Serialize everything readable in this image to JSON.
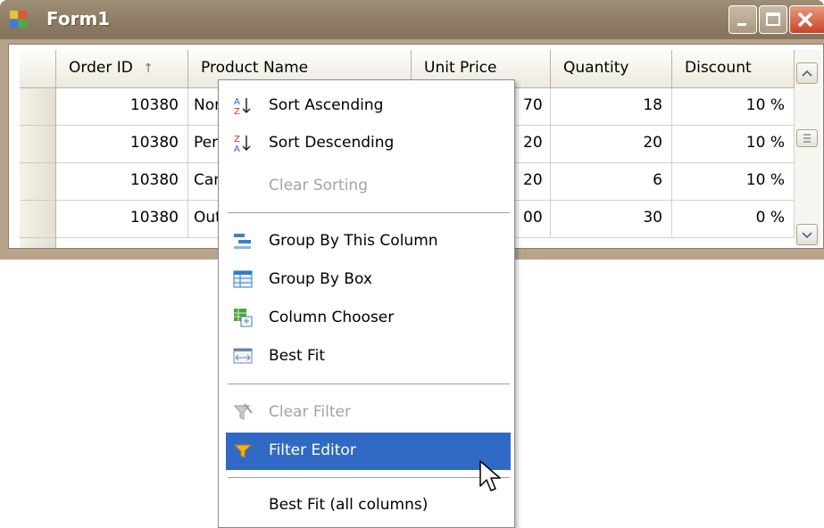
{
  "window": {
    "title": "Form1"
  },
  "grid": {
    "columns": [
      {
        "label": "Order ID",
        "sort_icon": "↑"
      },
      {
        "label": "Product Name"
      },
      {
        "label": "Unit Price"
      },
      {
        "label": "Quantity"
      },
      {
        "label": "Discount"
      }
    ],
    "rows": [
      {
        "order_id": "10380",
        "product": "Nord",
        "price": "70",
        "quantity": "18",
        "discount": "10 %"
      },
      {
        "order_id": "10380",
        "product": "Pert",
        "price": "20",
        "quantity": "20",
        "discount": "10 %"
      },
      {
        "order_id": "10380",
        "product": "Cam",
        "price": "20",
        "quantity": "6",
        "discount": "10 %"
      },
      {
        "order_id": "10380",
        "product": "Out",
        "price": "00",
        "quantity": "30",
        "discount": "0 %"
      }
    ]
  },
  "menu": {
    "sort_ascending": "Sort Ascending",
    "sort_descending": "Sort Descending",
    "clear_sorting": "Clear Sorting",
    "group_by_column": "Group By This Column",
    "group_by_box": "Group By Box",
    "column_chooser": "Column Chooser",
    "best_fit": "Best Fit",
    "clear_filter": "Clear Filter",
    "filter_editor": "Filter Editor",
    "best_fit_all": "Best Fit (all columns)"
  },
  "colors": {
    "selection": "#316ac5",
    "title_bar": "#8c7b63",
    "close_button": "#c8432b"
  }
}
